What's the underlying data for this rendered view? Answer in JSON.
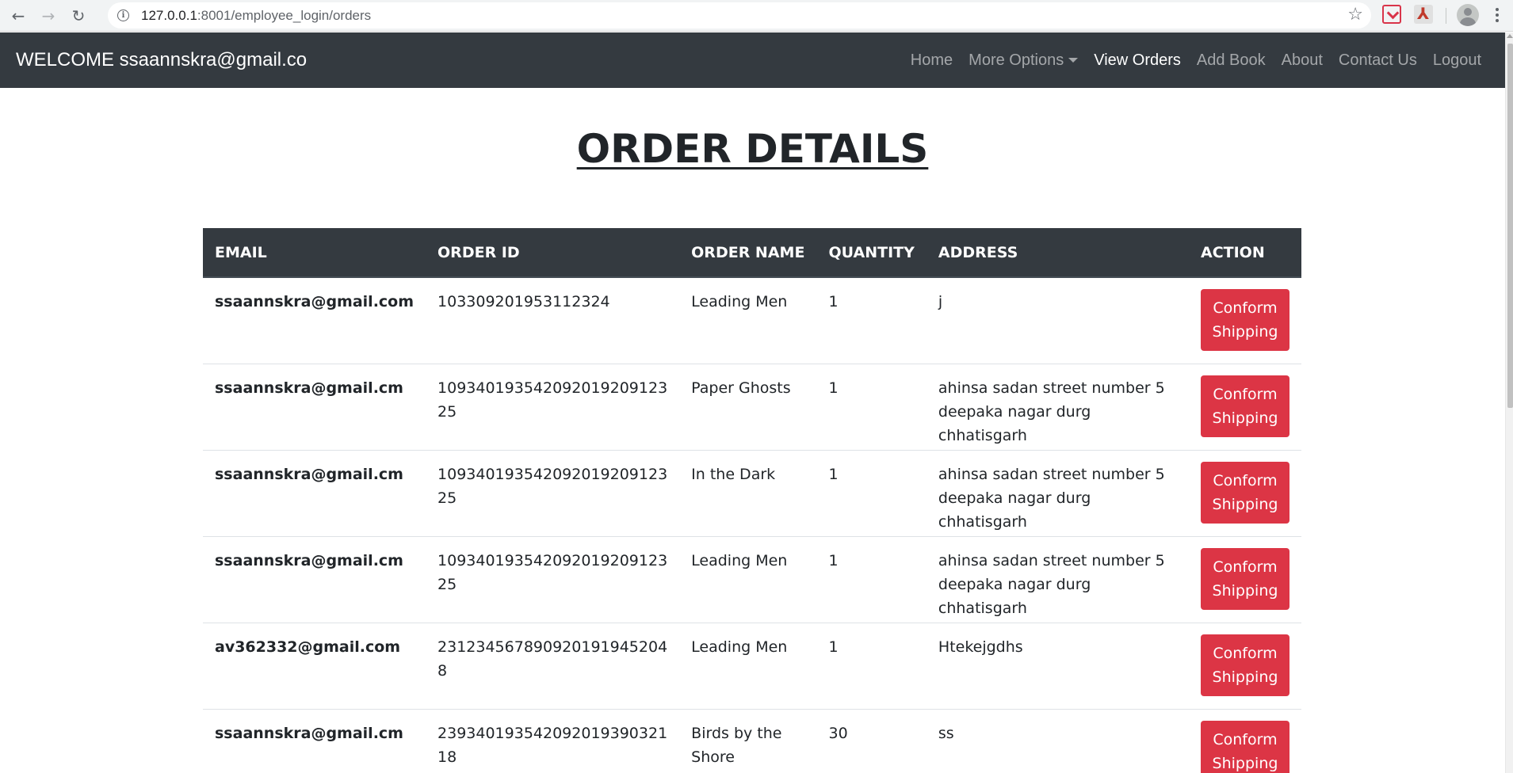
{
  "browser": {
    "url_host": "127.0.0.1",
    "url_path": ":8001/employee_login/orders"
  },
  "navbar": {
    "brand": "WELCOME ssaannskra@gmail.co",
    "links": [
      {
        "label": "Home"
      },
      {
        "label": "More Options"
      },
      {
        "label": "View Orders"
      },
      {
        "label": "Add Book"
      },
      {
        "label": "About"
      },
      {
        "label": "Contact Us"
      },
      {
        "label": "Logout"
      }
    ]
  },
  "page_title": "ORDER DETAILS",
  "table": {
    "headers": [
      "EMAIL",
      "ORDER ID",
      "ORDER NAME",
      "QUANTITY",
      "ADDRESS",
      "ACTION"
    ],
    "action_label_line1": "Conform",
    "action_label_line2": "Shipping",
    "rows": [
      {
        "email": "ssaannskra@gmail.com",
        "order_id": "103309201953112324",
        "order_name": "Leading Men",
        "quantity": "1",
        "address": "j"
      },
      {
        "email": "ssaannskra@gmail.cm",
        "order_id": "109340193542092019209123​25",
        "order_name": "Paper Ghosts",
        "quantity": "1",
        "address": "ahinsa sadan street number 5 deepaka nagar durg chhatisgarh"
      },
      {
        "email": "ssaannskra@gmail.cm",
        "order_id": "109340193542092019209123​25",
        "order_name": "In the Dark",
        "quantity": "1",
        "address": "ahinsa sadan street number 5 deepaka nagar durg chhatisgarh"
      },
      {
        "email": "ssaannskra@gmail.cm",
        "order_id": "109340193542092019209123​25",
        "order_name": "Leading Men",
        "quantity": "1",
        "address": "ahinsa sadan street number 5 deepaka nagar durg chhatisgarh"
      },
      {
        "email": "av362332@gmail.com",
        "order_id": "231234567890920191945204​8",
        "order_name": "Leading Men",
        "quantity": "1",
        "address": "Htekejgdhs"
      },
      {
        "email": "ssaannskra@gmail.cm",
        "order_id": "239340193542092019390321​18",
        "order_name": "Birds by the Shore",
        "quantity": "30",
        "address": "ss"
      }
    ]
  }
}
